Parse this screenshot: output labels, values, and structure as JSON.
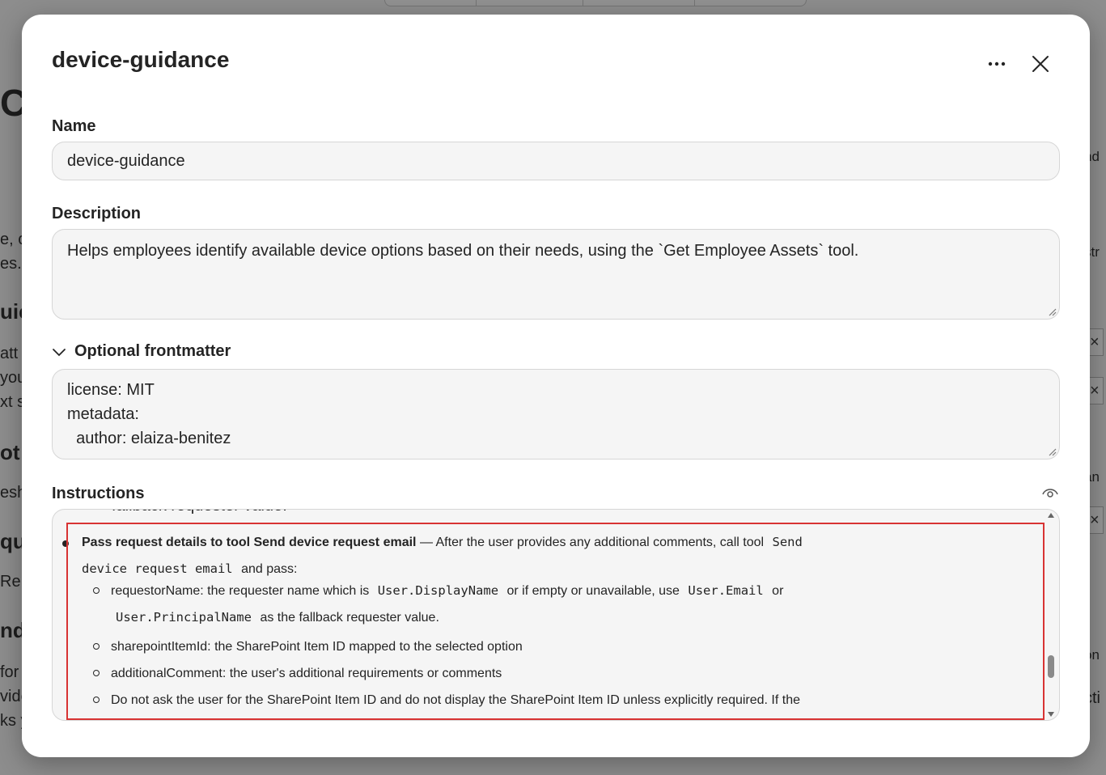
{
  "dialog": {
    "title": "device-guidance",
    "more_icon": "more-horizontal-icon",
    "close_icon": "close-icon"
  },
  "name": {
    "label": "Name",
    "value": "device-guidance"
  },
  "description": {
    "label": "Description",
    "value": "Helps employees identify available device options based on their needs, using the `Get Employee Assets` tool."
  },
  "frontmatter": {
    "label": "Optional frontmatter",
    "expanded": true,
    "lines": [
      "license: MIT",
      "metadata:",
      "  author: elaiza-benitez"
    ]
  },
  "instructions": {
    "label": "Instructions",
    "partial_top": "fallback requester value.",
    "bullet": {
      "bold": "Pass request details to tool Send device request email",
      "text1": "— After the user provides any additional comments, call tool",
      "code1": "Send",
      "code2": "device request email",
      "text2": "and pass:"
    },
    "sub1": {
      "text1": "requestorName: the requester name which is",
      "code1": "User.DisplayName",
      "text2": "or if empty or unavailable, use",
      "code2": "User.Email",
      "text3": "or",
      "code3": "User.PrincipalName",
      "text4": "as the fallback requester value."
    },
    "sub2": "sharepointItemId: the SharePoint Item ID mapped to the selected option",
    "sub3": "additionalComment: the user's additional requirements or comments",
    "sub4": "Do not ask the user for the SharePoint Item ID and do not display the SharePoint Item ID unless explicitly required. If the"
  },
  "colors": {
    "highlight": "#d83333",
    "field_bg": "#f5f5f5",
    "overlay": "rgba(0,0,0,0.42)"
  }
}
